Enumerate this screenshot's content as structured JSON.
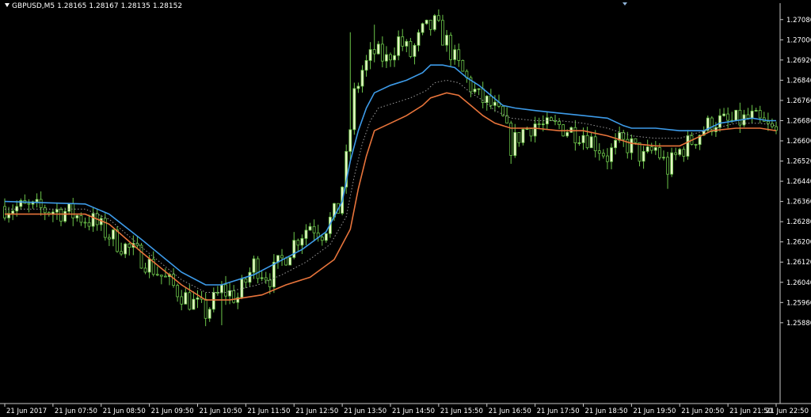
{
  "header": {
    "symbol": "GBPUSD,M5",
    "open": "1.28165",
    "high": "1.28167",
    "low": "1.28135",
    "close": "1.28152"
  },
  "chart_data": {
    "type": "candlestick",
    "symbol": "GBPUSD",
    "timeframe": "M5",
    "ylim": [
      1.2556,
      1.2712
    ],
    "xlim": [
      0,
      164
    ],
    "y_ticks": [
      1.2708,
      1.27,
      1.2692,
      1.2684,
      1.2676,
      1.2668,
      1.266,
      1.2652,
      1.2644,
      1.2636,
      1.2628,
      1.262,
      1.2612,
      1.2604,
      1.2596,
      1.2588
    ],
    "y_tick_labels": [
      "1.27080",
      "1.27000",
      "1.26920",
      "1.26840",
      "1.26760",
      "1.26680",
      "1.26600",
      "1.26520",
      "1.26440",
      "1.26360",
      "1.26280",
      "1.26200",
      "1.26120",
      "1.26040",
      "1.25960",
      "1.25880"
    ],
    "x_ticks": [
      0,
      12,
      24,
      36,
      48,
      60,
      72,
      84,
      96,
      108,
      120,
      132,
      144,
      156,
      168,
      180,
      192
    ],
    "x_tick_labels": [
      "21 Jun 2017",
      "21 Jun 07:50",
      "21 Jun 08:50",
      "21 Jun 09:50",
      "21 Jun 10:50",
      "21 Jun 11:50",
      "21 Jun 12:50",
      "21 Jun 13:50",
      "21 Jun 14:50",
      "21 Jun 15:50",
      "21 Jun 16:50",
      "21 Jun 17:50",
      "21 Jun 18:50",
      "21 Jun 19:50",
      "21 Jun 20:50",
      "21 Jun 21:50",
      "21 Jun 22:50"
    ],
    "price_anchors": [
      [
        0,
        1.2634
      ],
      [
        8,
        1.2633
      ],
      [
        15,
        1.2632
      ],
      [
        22,
        1.2628
      ],
      [
        28,
        1.262
      ],
      [
        34,
        1.2614
      ],
      [
        40,
        1.2605
      ],
      [
        45,
        1.2598
      ],
      [
        50,
        1.2592
      ],
      [
        54,
        1.2601
      ],
      [
        58,
        1.2598
      ],
      [
        62,
        1.2611
      ],
      [
        66,
        1.2606
      ],
      [
        70,
        1.2615
      ],
      [
        73,
        1.2622
      ],
      [
        76,
        1.2627
      ],
      [
        79,
        1.2624
      ],
      [
        83,
        1.2633
      ],
      [
        85,
        1.2652
      ],
      [
        87,
        1.2678
      ],
      [
        89,
        1.2688
      ],
      [
        92,
        1.2695
      ],
      [
        95,
        1.2692
      ],
      [
        98,
        1.27
      ],
      [
        101,
        1.2694
      ],
      [
        104,
        1.2703
      ],
      [
        107,
        1.2706
      ],
      [
        110,
        1.2699
      ],
      [
        112,
        1.2692
      ],
      [
        115,
        1.2684
      ],
      [
        118,
        1.2677
      ],
      [
        121,
        1.2674
      ],
      [
        124,
        1.2668
      ],
      [
        126,
        1.2658
      ],
      [
        129,
        1.2664
      ],
      [
        132,
        1.2667
      ],
      [
        135,
        1.2665
      ],
      [
        138,
        1.2666
      ],
      [
        141,
        1.2664
      ],
      [
        144,
        1.2663
      ],
      [
        147,
        1.2659
      ],
      [
        150,
        1.2654
      ],
      [
        153,
        1.2659
      ],
      [
        156,
        1.2658
      ],
      [
        159,
        1.2653
      ],
      [
        162,
        1.2657
      ],
      [
        165,
        1.2649
      ],
      [
        168,
        1.2656
      ],
      [
        171,
        1.266
      ],
      [
        174,
        1.2665
      ],
      [
        177,
        1.2668
      ],
      [
        180,
        1.2667
      ],
      [
        183,
        1.2668
      ],
      [
        186,
        1.2669
      ],
      [
        189,
        1.2666
      ],
      [
        192,
        1.2663
      ]
    ],
    "wick_spikes": [
      [
        86,
        1.2703
      ],
      [
        85,
        1.2647
      ],
      [
        92,
        1.2706
      ],
      [
        105,
        1.2708
      ],
      [
        108,
        1.2709
      ],
      [
        54,
        1.2587
      ],
      [
        165,
        1.2641
      ],
      [
        126,
        1.2654
      ]
    ],
    "series": [
      {
        "name": "",
        "color": "#3d9be9",
        "values": [
          [
            0,
            1.2636
          ],
          [
            20,
            1.2635
          ],
          [
            26,
            1.2631
          ],
          [
            34,
            1.2621
          ],
          [
            44,
            1.2608
          ],
          [
            50,
            1.2603
          ],
          [
            54,
            1.2603
          ],
          [
            62,
            1.2607
          ],
          [
            68,
            1.2612
          ],
          [
            74,
            1.2617
          ],
          [
            80,
            1.2624
          ],
          [
            84,
            1.2636
          ],
          [
            86,
            1.2652
          ],
          [
            88,
            1.2664
          ],
          [
            90,
            1.2673
          ],
          [
            92,
            1.2679
          ],
          [
            96,
            1.2682
          ],
          [
            100,
            1.2684
          ],
          [
            104,
            1.2687
          ],
          [
            106,
            1.269
          ],
          [
            109,
            1.269
          ],
          [
            112,
            1.2689
          ],
          [
            115,
            1.2685
          ],
          [
            118,
            1.2682
          ],
          [
            121,
            1.2678
          ],
          [
            124,
            1.2674
          ],
          [
            127,
            1.2673
          ],
          [
            132,
            1.2672
          ],
          [
            138,
            1.2671
          ],
          [
            144,
            1.267
          ],
          [
            150,
            1.2669
          ],
          [
            154,
            1.2666
          ],
          [
            156,
            1.2665
          ],
          [
            162,
            1.2665
          ],
          [
            168,
            1.2664
          ],
          [
            174,
            1.2664
          ],
          [
            178,
            1.2667
          ],
          [
            182,
            1.2668
          ],
          [
            186,
            1.2669
          ],
          [
            190,
            1.2668
          ],
          [
            192,
            1.2668
          ]
        ]
      },
      {
        "name": "",
        "color": "#e8743b",
        "values": [
          [
            0,
            1.2631
          ],
          [
            20,
            1.2631
          ],
          [
            26,
            1.2627
          ],
          [
            34,
            1.2616
          ],
          [
            44,
            1.2603
          ],
          [
            50,
            1.2597
          ],
          [
            56,
            1.2597
          ],
          [
            64,
            1.2599
          ],
          [
            70,
            1.2603
          ],
          [
            76,
            1.2606
          ],
          [
            82,
            1.2613
          ],
          [
            86,
            1.2625
          ],
          [
            88,
            1.2641
          ],
          [
            90,
            1.2654
          ],
          [
            92,
            1.2664
          ],
          [
            96,
            1.2667
          ],
          [
            100,
            1.267
          ],
          [
            104,
            1.2674
          ],
          [
            106,
            1.2677
          ],
          [
            110,
            1.2679
          ],
          [
            113,
            1.2678
          ],
          [
            116,
            1.2674
          ],
          [
            119,
            1.267
          ],
          [
            122,
            1.2667
          ],
          [
            126,
            1.2665
          ],
          [
            132,
            1.2665
          ],
          [
            138,
            1.2664
          ],
          [
            144,
            1.2664
          ],
          [
            150,
            1.2662
          ],
          [
            156,
            1.2659
          ],
          [
            162,
            1.2658
          ],
          [
            168,
            1.2658
          ],
          [
            172,
            1.2661
          ],
          [
            176,
            1.2664
          ],
          [
            182,
            1.2665
          ],
          [
            188,
            1.2665
          ],
          [
            192,
            1.2664
          ]
        ]
      },
      {
        "name": "",
        "color": "#9a9a9a",
        "style": "dotted",
        "values": [
          [
            0,
            1.2633
          ],
          [
            20,
            1.2633
          ],
          [
            26,
            1.2629
          ],
          [
            34,
            1.2618
          ],
          [
            44,
            1.2605
          ],
          [
            50,
            1.26
          ],
          [
            55,
            1.26
          ],
          [
            63,
            1.2603
          ],
          [
            69,
            1.2607
          ],
          [
            75,
            1.2612
          ],
          [
            81,
            1.2619
          ],
          [
            85,
            1.263
          ],
          [
            87,
            1.2646
          ],
          [
            89,
            1.2659
          ],
          [
            91,
            1.2668
          ],
          [
            93,
            1.2673
          ],
          [
            97,
            1.2675
          ],
          [
            101,
            1.2677
          ],
          [
            105,
            1.268
          ],
          [
            107,
            1.2683
          ],
          [
            110,
            1.2684
          ],
          [
            113,
            1.2683
          ],
          [
            116,
            1.2679
          ],
          [
            119,
            1.2676
          ],
          [
            122,
            1.2672
          ],
          [
            126,
            1.2669
          ],
          [
            132,
            1.2668
          ],
          [
            138,
            1.2668
          ],
          [
            144,
            1.2667
          ],
          [
            150,
            1.2665
          ],
          [
            156,
            1.2662
          ],
          [
            162,
            1.2661
          ],
          [
            168,
            1.2661
          ],
          [
            172,
            1.2663
          ],
          [
            177,
            1.2665
          ],
          [
            182,
            1.2667
          ],
          [
            188,
            1.2667
          ],
          [
            192,
            1.2666
          ]
        ]
      }
    ],
    "colors": {
      "background": "#000000",
      "axis": "#c8c8c8",
      "text": "#ffffff",
      "bull_body": "#e8f5c8",
      "bear_body": "#000000",
      "candle_wick": "#6cc64a"
    },
    "grid": false
  }
}
